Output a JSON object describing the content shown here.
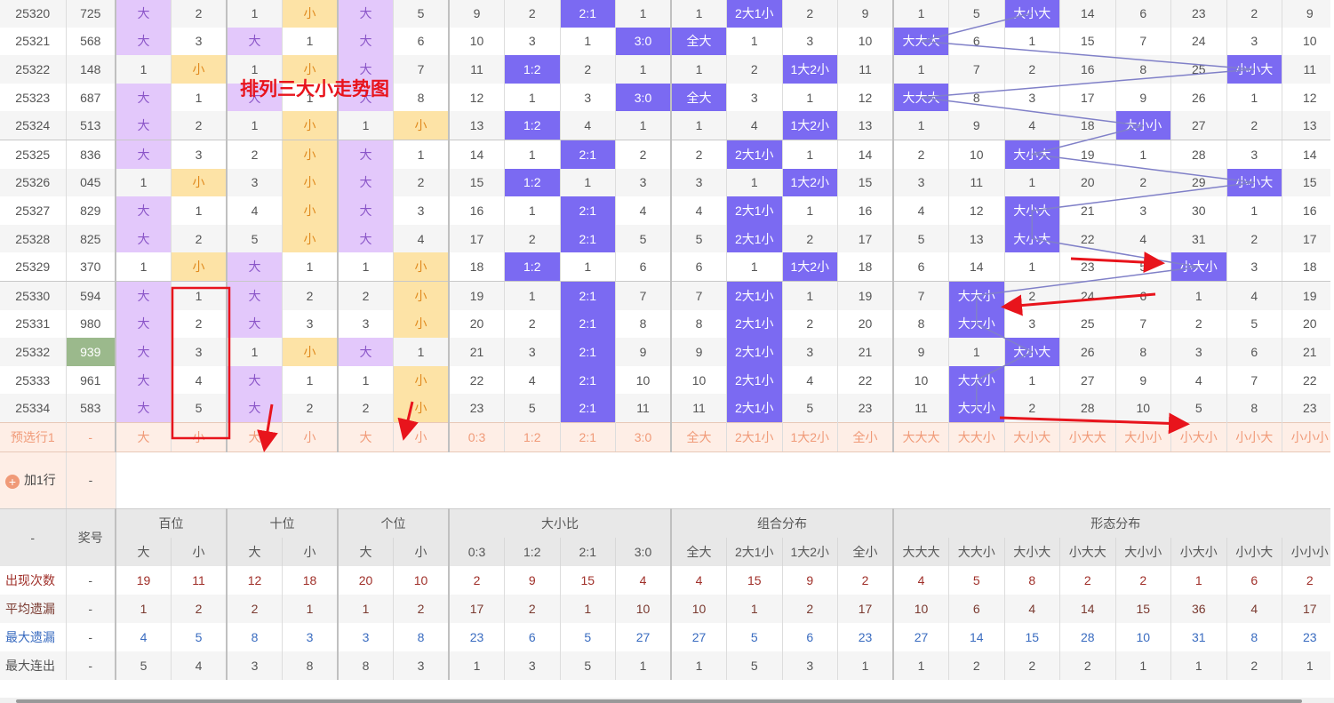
{
  "title_overlay": "排列三大小走势图",
  "rows": [
    {
      "issue": "25320",
      "num": "725",
      "cells": [
        "大",
        "2",
        "1",
        "小",
        "大",
        "5",
        "9",
        "2",
        "2:1",
        "1",
        "1",
        "2大1小",
        "2",
        "9",
        "1",
        "5",
        "大小大",
        "14",
        "6",
        "23",
        "2",
        "9"
      ]
    },
    {
      "issue": "25321",
      "num": "568",
      "cells": [
        "大",
        "3",
        "大",
        "1",
        "大",
        "6",
        "10",
        "3",
        "1",
        "3:0",
        "全大",
        "1",
        "3",
        "10",
        "大大大",
        "6",
        "1",
        "15",
        "7",
        "24",
        "3",
        "10"
      ]
    },
    {
      "issue": "25322",
      "num": "148",
      "cells": [
        "1",
        "小",
        "1",
        "小",
        "大",
        "7",
        "11",
        "1:2",
        "2",
        "1",
        "1",
        "2",
        "1大2小",
        "11",
        "1",
        "7",
        "2",
        "16",
        "8",
        "25",
        "小小大",
        "11"
      ]
    },
    {
      "issue": "25323",
      "num": "687",
      "cells": [
        "大",
        "1",
        "大",
        "1",
        "大",
        "8",
        "12",
        "1",
        "3",
        "3:0",
        "全大",
        "3",
        "1",
        "12",
        "大大大",
        "8",
        "3",
        "17",
        "9",
        "26",
        "1",
        "12"
      ]
    },
    {
      "issue": "25324",
      "num": "513",
      "cells": [
        "大",
        "2",
        "1",
        "小",
        "1",
        "小",
        "13",
        "1:2",
        "4",
        "1",
        "1",
        "4",
        "1大2小",
        "13",
        "1",
        "9",
        "4",
        "18",
        "大小小",
        "27",
        "2",
        "13"
      ]
    },
    {
      "issue": "25325",
      "num": "836",
      "cells": [
        "大",
        "3",
        "2",
        "小",
        "大",
        "1",
        "14",
        "1",
        "2:1",
        "2",
        "2",
        "2大1小",
        "1",
        "14",
        "2",
        "10",
        "大小大",
        "19",
        "1",
        "28",
        "3",
        "14"
      ]
    },
    {
      "issue": "25326",
      "num": "045",
      "cells": [
        "1",
        "小",
        "3",
        "小",
        "大",
        "2",
        "15",
        "1:2",
        "1",
        "3",
        "3",
        "1",
        "1大2小",
        "15",
        "3",
        "11",
        "1",
        "20",
        "2",
        "29",
        "小小大",
        "15"
      ]
    },
    {
      "issue": "25327",
      "num": "829",
      "cells": [
        "大",
        "1",
        "4",
        "小",
        "大",
        "3",
        "16",
        "1",
        "2:1",
        "4",
        "4",
        "2大1小",
        "1",
        "16",
        "4",
        "12",
        "大小大",
        "21",
        "3",
        "30",
        "1",
        "16"
      ]
    },
    {
      "issue": "25328",
      "num": "825",
      "cells": [
        "大",
        "2",
        "5",
        "小",
        "大",
        "4",
        "17",
        "2",
        "2:1",
        "5",
        "5",
        "2大1小",
        "2",
        "17",
        "5",
        "13",
        "大小大",
        "22",
        "4",
        "31",
        "2",
        "17"
      ]
    },
    {
      "issue": "25329",
      "num": "370",
      "cells": [
        "1",
        "小",
        "大",
        "1",
        "1",
        "小",
        "18",
        "1:2",
        "1",
        "6",
        "6",
        "1",
        "1大2小",
        "18",
        "6",
        "14",
        "1",
        "23",
        "5",
        "小大小",
        "3",
        "18"
      ]
    },
    {
      "issue": "25330",
      "num": "594",
      "cells": [
        "大",
        "1",
        "大",
        "2",
        "2",
        "小",
        "19",
        "1",
        "2:1",
        "7",
        "7",
        "2大1小",
        "1",
        "19",
        "7",
        "大大小",
        "2",
        "24",
        "6",
        "1",
        "4",
        "19"
      ]
    },
    {
      "issue": "25331",
      "num": "980",
      "cells": [
        "大",
        "2",
        "大",
        "3",
        "3",
        "小",
        "20",
        "2",
        "2:1",
        "8",
        "8",
        "2大1小",
        "2",
        "20",
        "8",
        "大大小",
        "3",
        "25",
        "7",
        "2",
        "5",
        "20"
      ]
    },
    {
      "issue": "25332",
      "num": "939",
      "highlight": true,
      "cells": [
        "大",
        "3",
        "1",
        "小",
        "大",
        "1",
        "21",
        "3",
        "2:1",
        "9",
        "9",
        "2大1小",
        "3",
        "21",
        "9",
        "1",
        "大小大",
        "26",
        "8",
        "3",
        "6",
        "21"
      ]
    },
    {
      "issue": "25333",
      "num": "961",
      "cells": [
        "大",
        "4",
        "大",
        "1",
        "1",
        "小",
        "22",
        "4",
        "2:1",
        "10",
        "10",
        "2大1小",
        "4",
        "22",
        "10",
        "大大小",
        "1",
        "27",
        "9",
        "4",
        "7",
        "22"
      ]
    },
    {
      "issue": "25334",
      "num": "583",
      "cells": [
        "大",
        "5",
        "大",
        "2",
        "2",
        "小",
        "23",
        "5",
        "2:1",
        "11",
        "11",
        "2大1小",
        "5",
        "23",
        "11",
        "大大小",
        "2",
        "28",
        "10",
        "5",
        "8",
        "23"
      ]
    }
  ],
  "preselect": {
    "label": "预选行1",
    "num": "-",
    "cells": [
      "大",
      "小",
      "大",
      "小",
      "大",
      "小",
      "0:3",
      "1:2",
      "2:1",
      "3:0",
      "全大",
      "2大1小",
      "1大2小",
      "全小",
      "大大大",
      "大大小",
      "大小大",
      "小大大",
      "大小小",
      "小大小",
      "小小大",
      "小小小"
    ]
  },
  "add_row": {
    "label": "加1行",
    "num": "-",
    "icon": "plus-circle-icon"
  },
  "footer_header": {
    "corner": "-",
    "num_label": "奖号",
    "groups": [
      {
        "label": "百位",
        "span": 2
      },
      {
        "label": "十位",
        "span": 2
      },
      {
        "label": "个位",
        "span": 2
      },
      {
        "label": "大小比",
        "span": 4
      },
      {
        "label": "组合分布",
        "span": 4
      },
      {
        "label": "形态分布",
        "span": 8
      }
    ],
    "cols": [
      "大",
      "小",
      "大",
      "小",
      "大",
      "小",
      "0:3",
      "1:2",
      "2:1",
      "3:0",
      "全大",
      "2大1小",
      "1大2小",
      "全小",
      "大大大",
      "大大小",
      "大小大",
      "小大大",
      "大小小",
      "小大小",
      "小小大",
      "小小小"
    ]
  },
  "stats": [
    {
      "label": "出现次数",
      "num": "-",
      "color": "red",
      "values": [
        "19",
        "11",
        "12",
        "18",
        "20",
        "10",
        "2",
        "9",
        "15",
        "4",
        "4",
        "15",
        "9",
        "2",
        "4",
        "5",
        "8",
        "2",
        "2",
        "1",
        "6",
        "2"
      ]
    },
    {
      "label": "平均遗漏",
      "num": "-",
      "color": "brown",
      "values": [
        "1",
        "2",
        "2",
        "1",
        "1",
        "2",
        "17",
        "2",
        "1",
        "10",
        "10",
        "1",
        "2",
        "17",
        "10",
        "6",
        "4",
        "14",
        "15",
        "36",
        "4",
        "17"
      ]
    },
    {
      "label": "最大遗漏",
      "num": "-",
      "color": "blue",
      "values": [
        "4",
        "5",
        "8",
        "3",
        "3",
        "8",
        "23",
        "6",
        "5",
        "27",
        "27",
        "5",
        "6",
        "23",
        "27",
        "14",
        "15",
        "28",
        "10",
        "31",
        "8",
        "23"
      ]
    },
    {
      "label": "最大连出",
      "num": "-",
      "color": "gray",
      "values": [
        "5",
        "4",
        "3",
        "8",
        "8",
        "3",
        "1",
        "3",
        "5",
        "1",
        "1",
        "5",
        "3",
        "1",
        "1",
        "2",
        "2",
        "2",
        "1",
        "1",
        "2",
        "1"
      ]
    }
  ],
  "colors": {
    "big_bg": "#e3c8fb",
    "small_bg": "#fde3a6",
    "hit_bg": "#7b6af2",
    "highlight_bg": "#9bb98c",
    "trend_line": "#8080c8",
    "annotation": "#e8141c"
  }
}
